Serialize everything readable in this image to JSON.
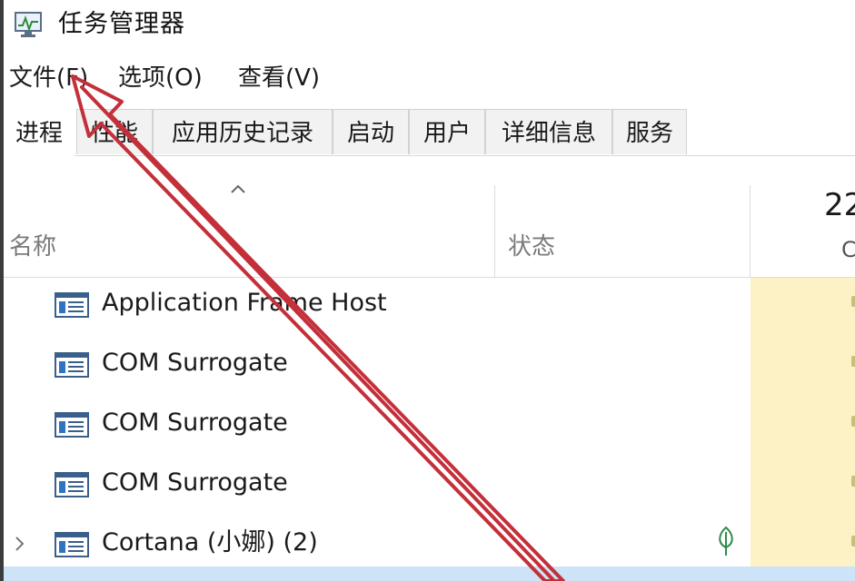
{
  "window": {
    "title": "任务管理器"
  },
  "menubar": {
    "items": [
      {
        "label": "文件(F)"
      },
      {
        "label": "选项(O)"
      },
      {
        "label": "查看(V)"
      }
    ]
  },
  "tabs": [
    {
      "label": "进程",
      "active": true
    },
    {
      "label": "性能"
    },
    {
      "label": "应用历史记录"
    },
    {
      "label": "启动"
    },
    {
      "label": "用户"
    },
    {
      "label": "详细信息"
    },
    {
      "label": "服务"
    }
  ],
  "columns": {
    "name": "名称",
    "status": "状态",
    "cpu_percent": "22",
    "cpu_label": "C"
  },
  "processes": [
    {
      "name": "Application Frame Host",
      "expandable": false,
      "suspended": false
    },
    {
      "name": "COM Surrogate",
      "expandable": false,
      "suspended": false
    },
    {
      "name": "COM Surrogate",
      "expandable": false,
      "suspended": false
    },
    {
      "name": "COM Surrogate",
      "expandable": false,
      "suspended": false
    },
    {
      "name": "Cortana (小娜) (2)",
      "expandable": true,
      "suspended": true
    }
  ],
  "colors": {
    "cpu_column_bg": "#fdf1c6",
    "annotation_arrow": "#c4303a",
    "selected_row": "#cde3f7"
  },
  "icons": {
    "app": "task-manager-icon",
    "process": "window-app-icon",
    "suspended": "leaf-icon",
    "sort": "sort-ascending-icon",
    "expand": "chevron-right-icon"
  }
}
